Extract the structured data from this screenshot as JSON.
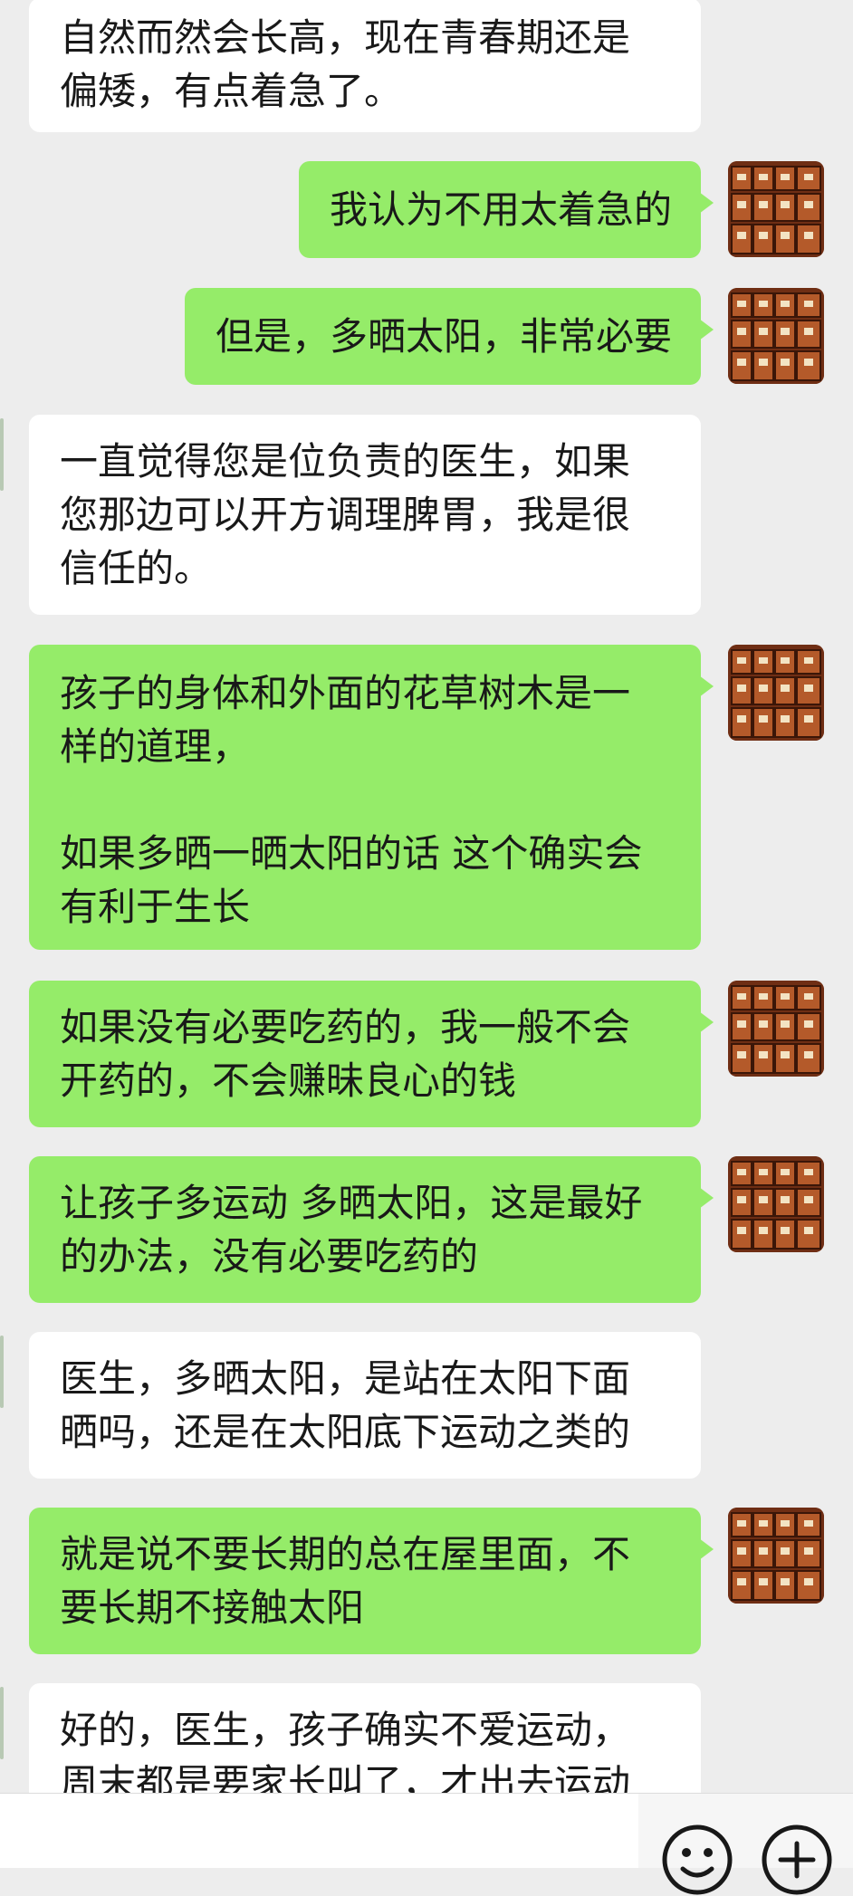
{
  "messages": [
    {
      "side": "in",
      "text": "自然而然会长高，现在青春期还是\n偏矮，有点着急了。"
    },
    {
      "side": "out",
      "text": "我认为不用太着急的"
    },
    {
      "side": "out",
      "text": "但是，多晒太阳，非常必要"
    },
    {
      "side": "in",
      "text": "一直觉得您是位负责的医生，如果\n您那边可以开方调理脾胃，我是很\n信任的。"
    },
    {
      "side": "out",
      "text": "孩子的身体和外面的花草树木是一\n样的道理，\n\n如果多晒一晒太阳的话 这个确实会\n有利于生长"
    },
    {
      "side": "out",
      "text": "如果没有必要吃药的，我一般不会\n开药的，不会赚昧良心的钱"
    },
    {
      "side": "out",
      "text": "让孩子多运动 多晒太阳，这是最好\n的办法，没有必要吃药的"
    },
    {
      "side": "in",
      "text": "医生，多晒太阳，是站在太阳下面\n晒吗，还是在太阳底下运动之类的"
    },
    {
      "side": "out",
      "text": "就是说不要长期的总在屋里面，不\n要长期不接触太阳"
    },
    {
      "side": "in",
      "text": "好的，医生，孩子确实不爱运动，\n周末都是要家长叫了，才出去运动"
    }
  ],
  "colors": {
    "background": "#ededed",
    "incoming_bubble": "#ffffff",
    "outgoing_bubble": "#95ec69",
    "text": "#191919"
  },
  "icons": {
    "avatar": "medicine-cabinet-avatar",
    "emoji": "emoji-icon",
    "more": "plus-circle-icon"
  }
}
